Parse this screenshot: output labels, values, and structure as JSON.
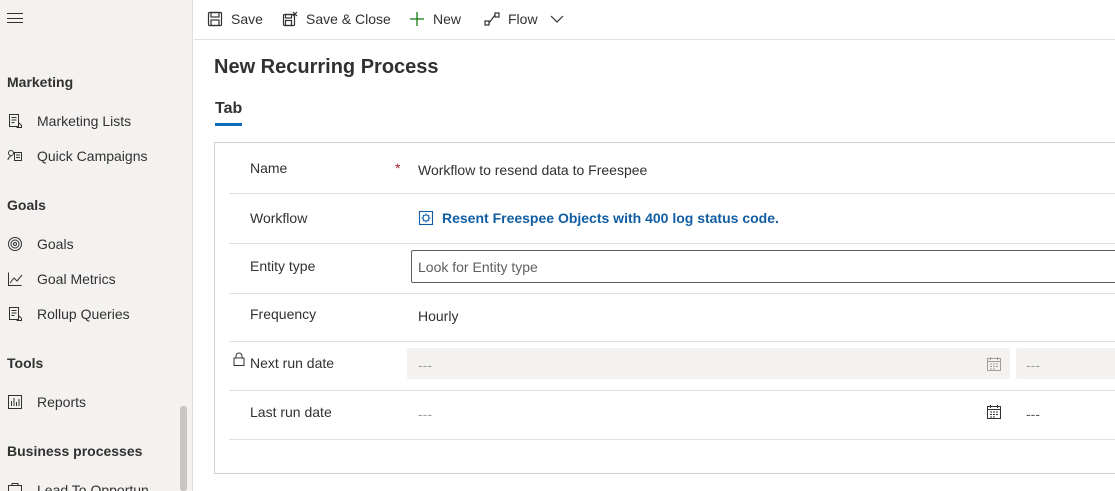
{
  "sidebar": {
    "sections": {
      "marketing": "Marketing",
      "goals": "Goals",
      "tools": "Tools",
      "business_processes": "Business processes"
    },
    "items": {
      "marketing_lists": "Marketing Lists",
      "quick_campaigns": "Quick Campaigns",
      "goals": "Goals",
      "goal_metrics": "Goal Metrics",
      "rollup_queries": "Rollup Queries",
      "reports": "Reports",
      "lead_to_opportunity": "Lead To Opportun"
    }
  },
  "toolbar": {
    "save": "Save",
    "save_close": "Save & Close",
    "new": "New",
    "flow": "Flow"
  },
  "page": {
    "title": "New Recurring Process",
    "tab": "Tab"
  },
  "form": {
    "name_label": "Name",
    "required_mark": "*",
    "name_value": "Workflow to resend data to Freespee",
    "workflow_label": "Workflow",
    "workflow_value": "Resent Freespee Objects with 400 log status code.",
    "entity_type_label": "Entity type",
    "entity_type_placeholder": "Look for Entity type",
    "frequency_label": "Frequency",
    "frequency_value": "Hourly",
    "next_run_label": "Next run date",
    "next_run_date": "---",
    "next_run_time": "---",
    "last_run_label": "Last run date",
    "last_run_date": "---",
    "last_run_time": "---"
  },
  "colors": {
    "accent": "#0f6cbd",
    "link": "#115ea3",
    "required": "#a4262c",
    "sidebar_bg": "#f3f2f1"
  }
}
